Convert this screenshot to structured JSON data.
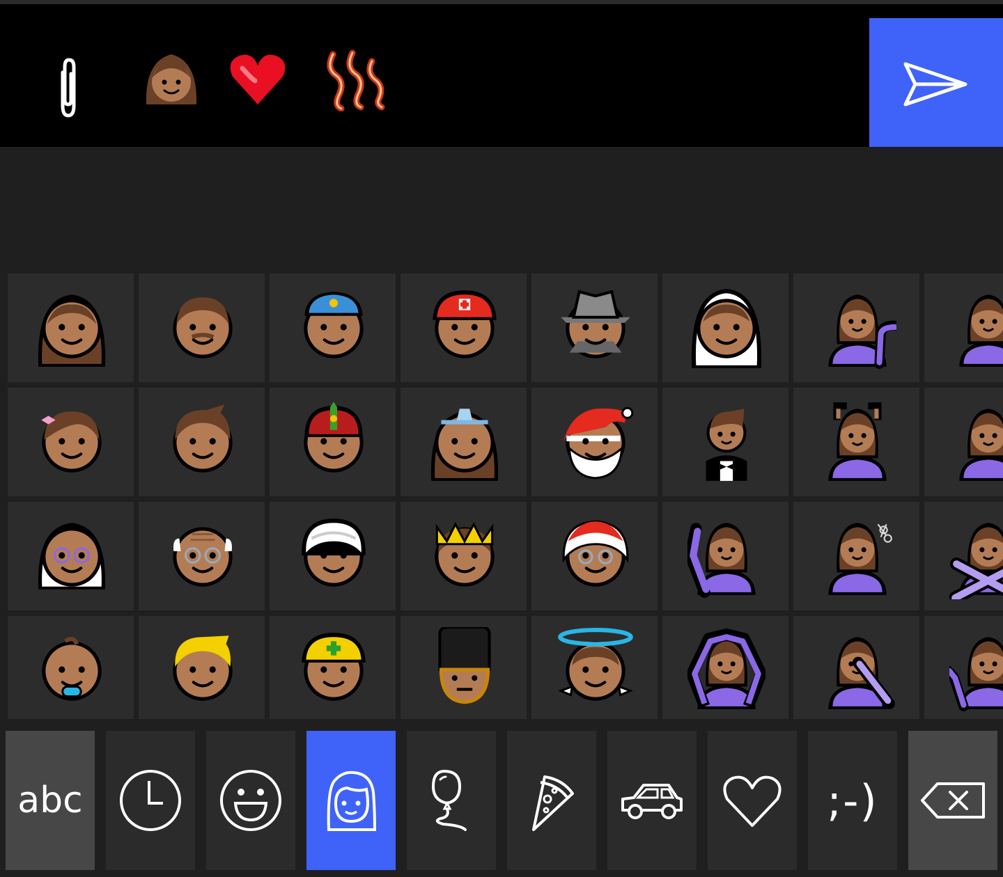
{
  "composer": {
    "attach_icon": "paperclip-icon",
    "composed_emojis": [
      "woman-medium-skin",
      "red-heart",
      "bacon"
    ],
    "send_icon": "send-icon",
    "colors": {
      "send_bg": "#3f63f8",
      "bar_bg": "#000000"
    }
  },
  "emoji_grid": {
    "rows": [
      [
        "woman",
        "man",
        "police-officer",
        "rescue-worker-helmet",
        "detective",
        "bride-with-veil",
        "person-tipping-hand",
        "person-pouting"
      ],
      [
        "girl",
        "boy",
        "man-with-chinese-cap",
        "princess",
        "santa-claus",
        "man-in-tuxedo",
        "person-getting-massage",
        "person-frowning"
      ],
      [
        "old-woman",
        "old-man",
        "person-wearing-turban",
        "prince",
        "mrs-claus",
        "person-raising-hand",
        "person-getting-haircut",
        "person-gesturing-no"
      ],
      [
        "baby",
        "blond-person",
        "construction-worker",
        "guard",
        "baby-angel",
        "person-gesturing-ok",
        "person-facepalming",
        "person-shrugging"
      ]
    ],
    "skin_tone": "#b47c55",
    "hair_color": "#6a4127",
    "cloth_color": "#8a68e6"
  },
  "category_bar": {
    "abc_label": "abc",
    "kaomoji_label": ";-)",
    "selected": "people",
    "keys": [
      {
        "id": "abc",
        "icon": "abc-text"
      },
      {
        "id": "recent",
        "icon": "clock-icon"
      },
      {
        "id": "smileys",
        "icon": "smiley-icon"
      },
      {
        "id": "people",
        "icon": "person-icon"
      },
      {
        "id": "celebration",
        "icon": "balloon-icon"
      },
      {
        "id": "food",
        "icon": "pizza-icon"
      },
      {
        "id": "travel",
        "icon": "car-icon"
      },
      {
        "id": "symbols",
        "icon": "heart-icon"
      },
      {
        "id": "kaomoji",
        "icon": "kaomoji-text"
      },
      {
        "id": "backspace",
        "icon": "backspace-icon"
      }
    ]
  }
}
